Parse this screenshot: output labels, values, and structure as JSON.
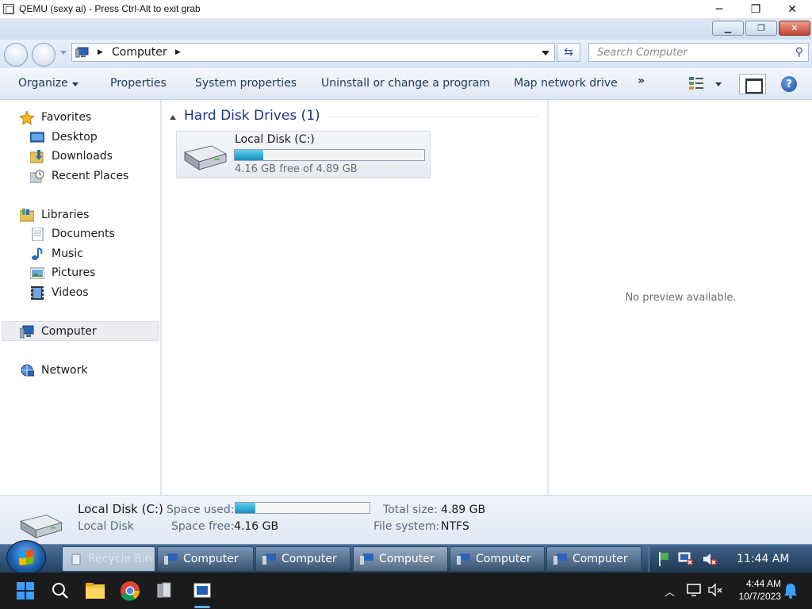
{
  "host": {
    "title": "QEMU (sexy ai) - Press Ctrl-Alt to exit grab",
    "minimize_glyph": "─",
    "maximize_glyph": "❐",
    "close_glyph": "✕"
  },
  "address_bar": {
    "location": "Computer",
    "search_placeholder": "Search Computer"
  },
  "command_bar": {
    "organize": "Organize",
    "properties": "Properties",
    "system_properties": "System properties",
    "uninstall": "Uninstall or change a program",
    "map_drive": "Map network drive",
    "more": "»"
  },
  "nav_pane": {
    "favorites": "Favorites",
    "desktop": "Desktop",
    "downloads": "Downloads",
    "recent_places": "Recent Places",
    "libraries": "Libraries",
    "documents": "Documents",
    "music": "Music",
    "pictures": "Pictures",
    "videos": "Videos",
    "computer": "Computer",
    "network": "Network"
  },
  "content": {
    "group_title": "Hard Disk Drives (1)",
    "drive_name": "Local Disk (C:)",
    "drive_free_text": "4.16 GB free of 4.89 GB",
    "used_fraction": 0.15
  },
  "preview": {
    "text": "No preview available."
  },
  "details": {
    "name": "Local Disk (C:)",
    "type": "Local Disk",
    "space_used_label": "Space used:",
    "space_free_label": "Space free:",
    "space_free_value": "4.16 GB",
    "total_size_label": "Total size:",
    "total_size_value": "4.89 GB",
    "file_system_label": "File system:",
    "file_system_value": "NTFS"
  },
  "guest_taskbar": {
    "tasks": [
      "Recycle Bin",
      "Computer",
      "Computer",
      "Computer",
      "Computer",
      "Computer"
    ],
    "clock": "11:44 AM"
  },
  "host_taskbar": {
    "time": "4:44 AM",
    "date": "10/7/2023"
  },
  "colors": {
    "accent": "#1e3287",
    "progress": "#1a8fbf"
  }
}
